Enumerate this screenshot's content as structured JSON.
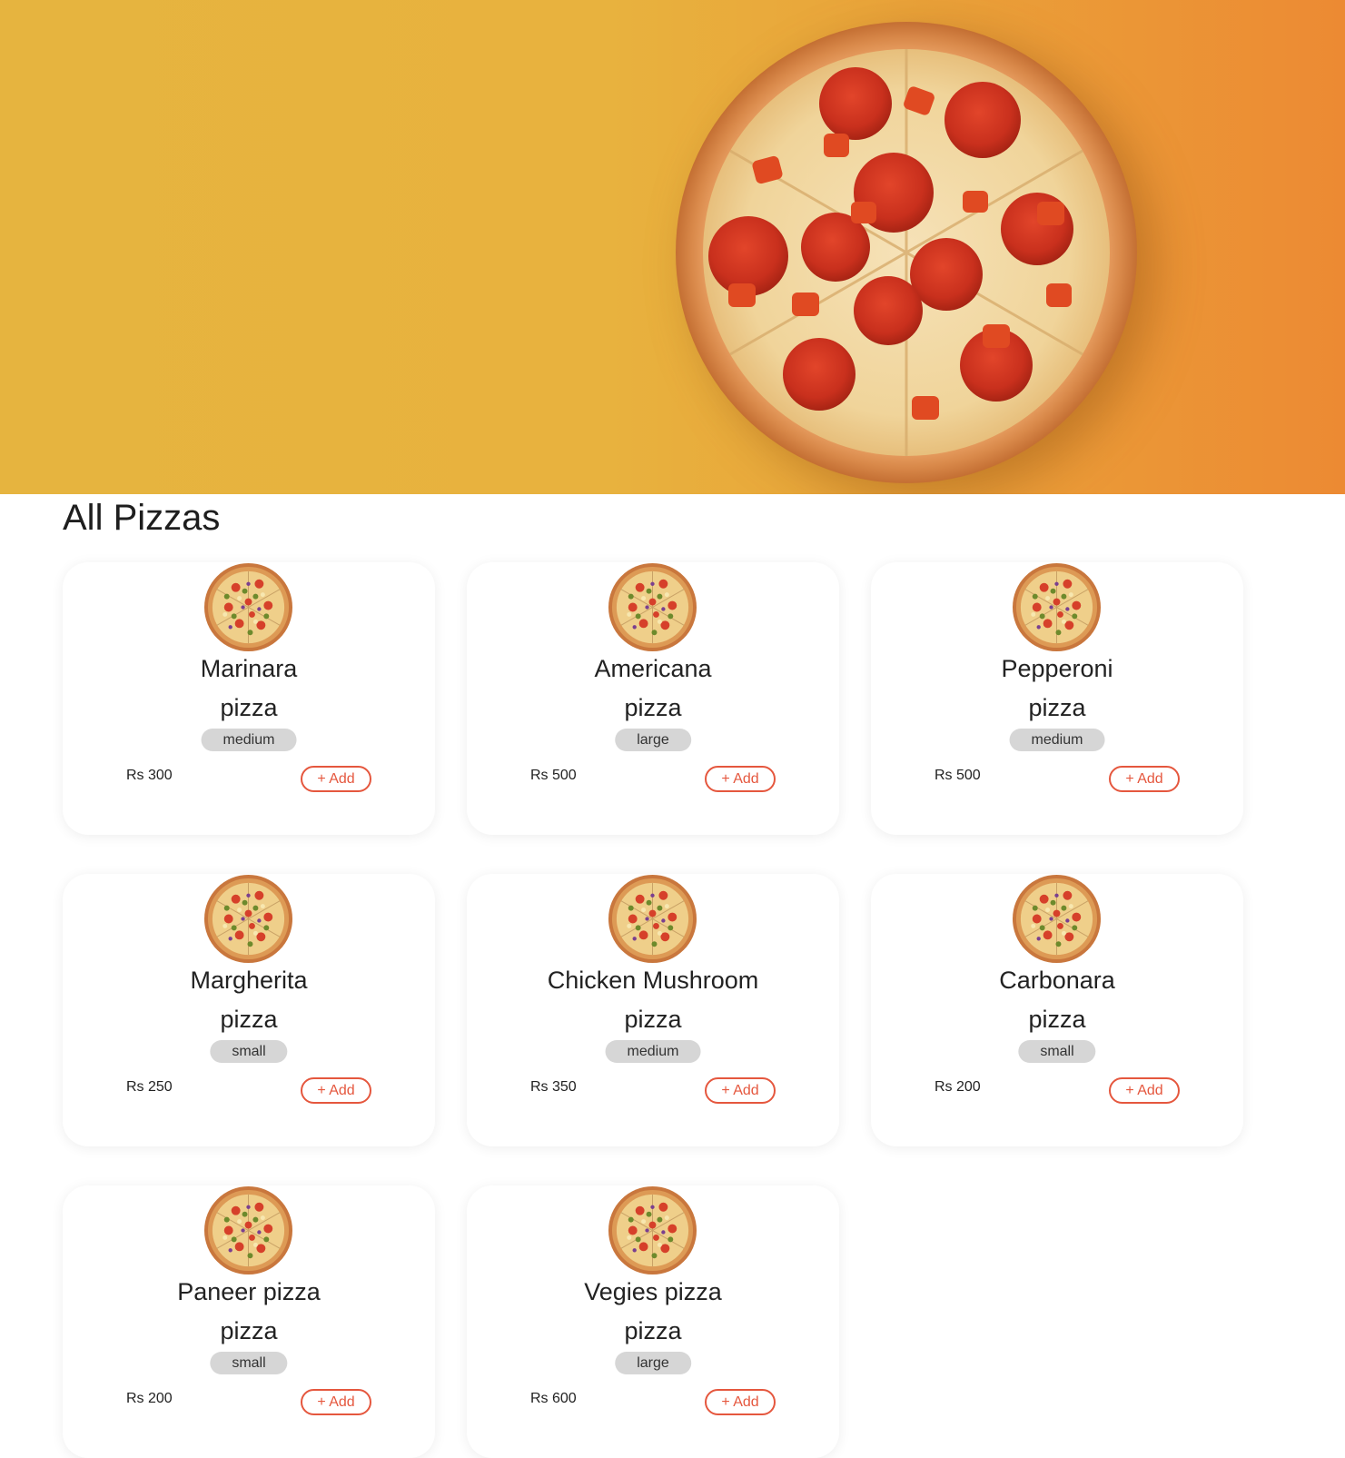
{
  "hero": {
    "image_icon": "pepperoni-pizza-image"
  },
  "section": {
    "title": "All Pizzas"
  },
  "colors": {
    "hero_gradient_start": "#e6b43f",
    "hero_gradient_end": "#ec8a33",
    "accent": "#e5573e",
    "badge_bg": "#d6d6d6"
  },
  "pizzas": [
    {
      "name": "Marinara",
      "sub": "pizza",
      "size": "medium",
      "price": "Rs 300",
      "add": "+ Add"
    },
    {
      "name": "Americana",
      "sub": "pizza",
      "size": "large",
      "price": "Rs 500",
      "add": "+ Add"
    },
    {
      "name": "Pepperoni",
      "sub": "pizza",
      "size": "medium",
      "price": "Rs 500",
      "add": "+ Add"
    },
    {
      "name": "Margherita",
      "sub": "pizza",
      "size": "small",
      "price": "Rs 250",
      "add": "+ Add"
    },
    {
      "name": "Chicken Mushroom",
      "sub": "pizza",
      "size": "medium",
      "price": "Rs 350",
      "add": "+ Add"
    },
    {
      "name": "Carbonara",
      "sub": "pizza",
      "size": "small",
      "price": "Rs 200",
      "add": "+ Add"
    },
    {
      "name": "Paneer pizza",
      "sub": "pizza",
      "size": "small",
      "price": "Rs 200",
      "add": "+ Add"
    },
    {
      "name": "Vegies pizza",
      "sub": "pizza",
      "size": "large",
      "price": "Rs 600",
      "add": "+ Add"
    }
  ]
}
